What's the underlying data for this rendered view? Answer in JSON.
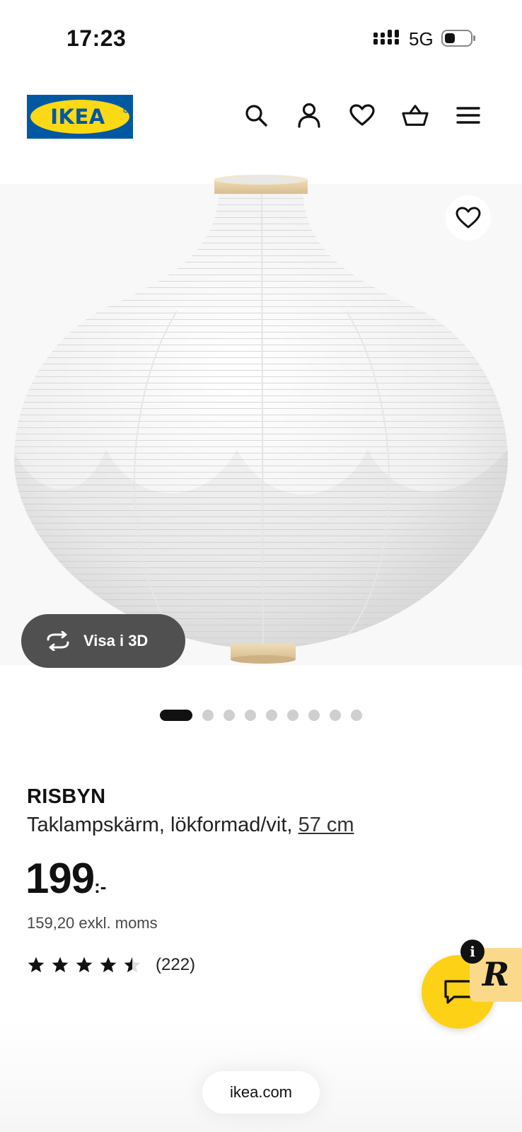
{
  "status_bar": {
    "time": "17:23",
    "network": "5G"
  },
  "header": {
    "logo_text": "IKEA",
    "icons": [
      "search-icon",
      "account-icon",
      "heart-icon",
      "basket-icon",
      "menu-icon"
    ]
  },
  "gallery": {
    "view3d_label": "Visa i 3D",
    "total_images": 9,
    "active_index": 0
  },
  "product": {
    "name": "RISBYN",
    "description": "Taklampskärm, lökformad/vit,",
    "size_link": "57 cm",
    "price_integer": "199",
    "price_suffix": ":-",
    "price_excl_vat": "159,20 exkl. moms",
    "rating_value": 4.5,
    "rating_count": "(222)"
  },
  "browser": {
    "url": "ikea.com"
  },
  "colors": {
    "ikea_blue": "#0058a3",
    "ikea_yellow": "#fbd914",
    "chat_yellow": "#fcd116"
  }
}
